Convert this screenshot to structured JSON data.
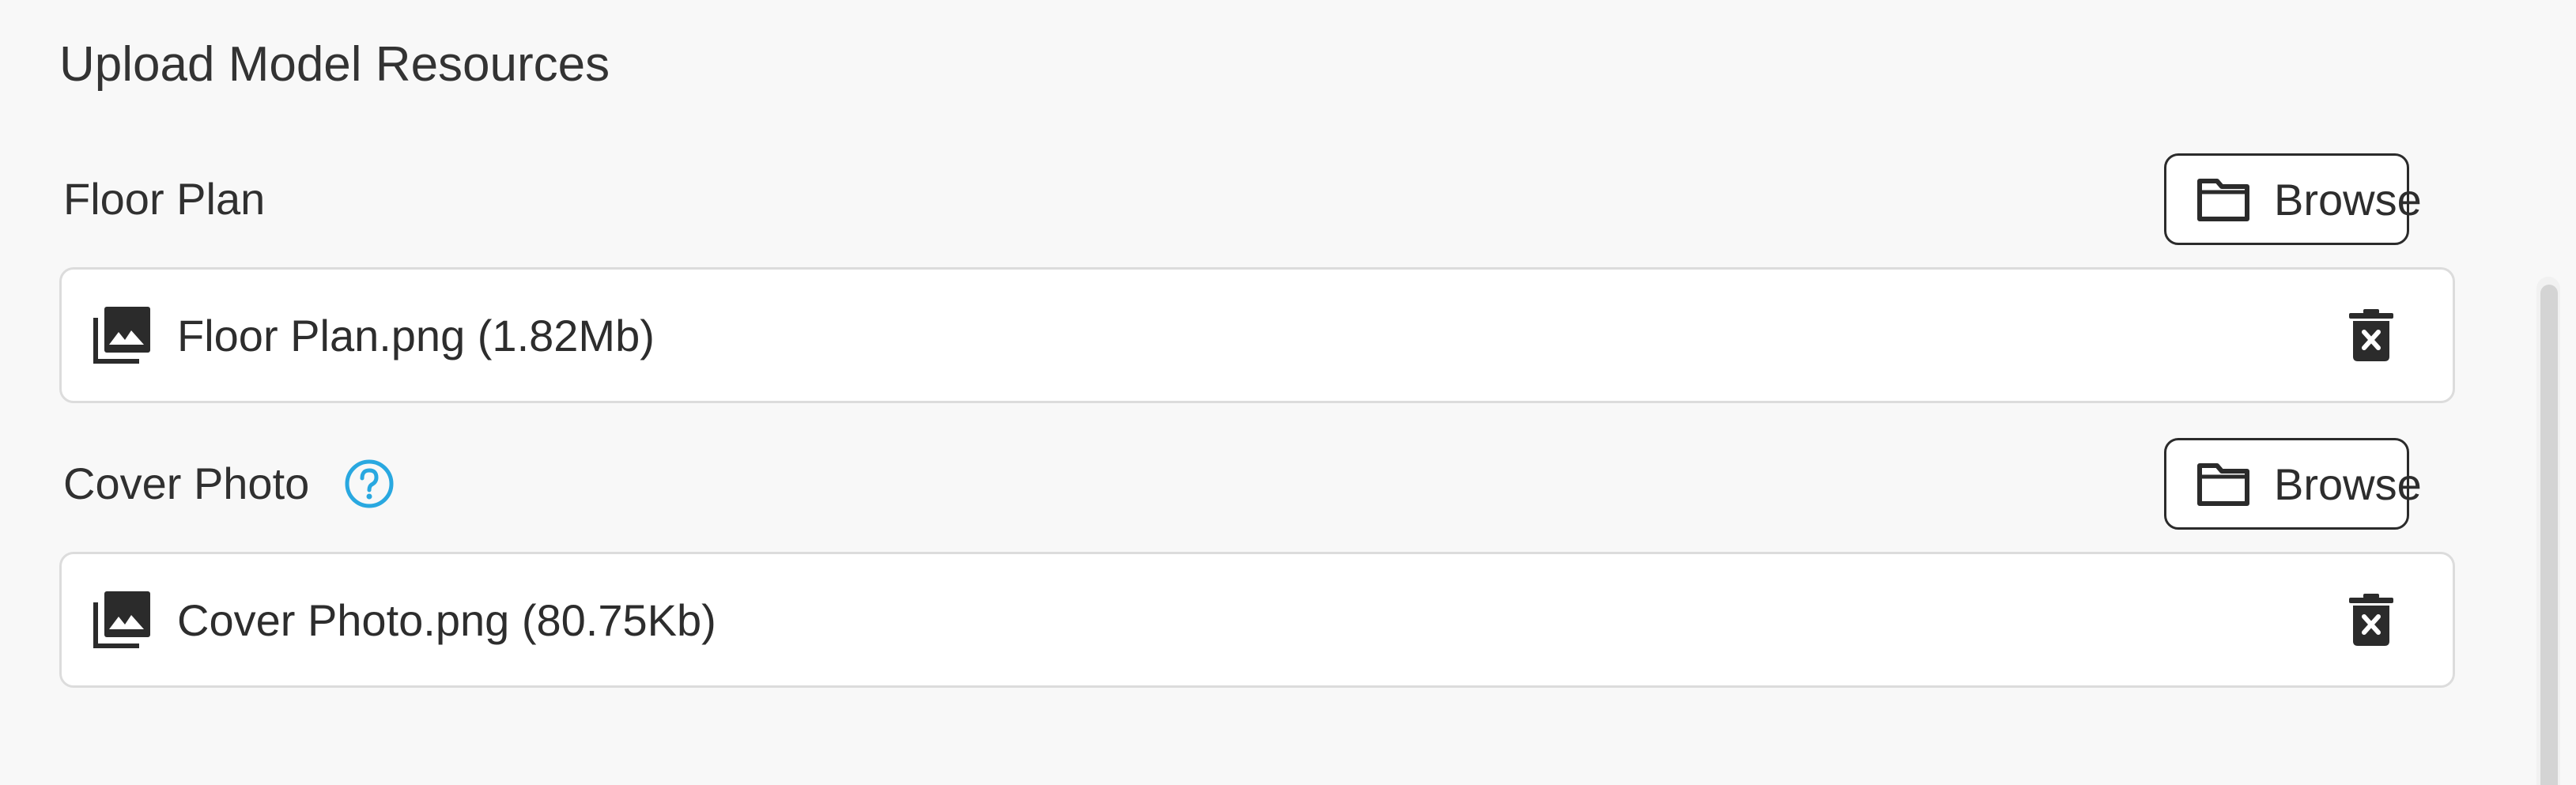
{
  "page": {
    "title": "Upload Model Resources"
  },
  "floor_plan": {
    "label": "Floor Plan",
    "browse_label": "Browse",
    "file": {
      "name": "Floor Plan.png (1.82Mb)",
      "icon": "image-library-icon"
    }
  },
  "cover_photo": {
    "label": "Cover Photo",
    "help_icon": "help-circle-icon",
    "browse_label": "Browse",
    "file": {
      "name": "Cover Photo.png (80.75Kb)",
      "icon": "image-library-icon"
    }
  },
  "colors": {
    "background": "#f8f8f8",
    "text": "#2d2d2d",
    "help_accent": "#29a8e0",
    "row_border": "#dcdcdc"
  }
}
